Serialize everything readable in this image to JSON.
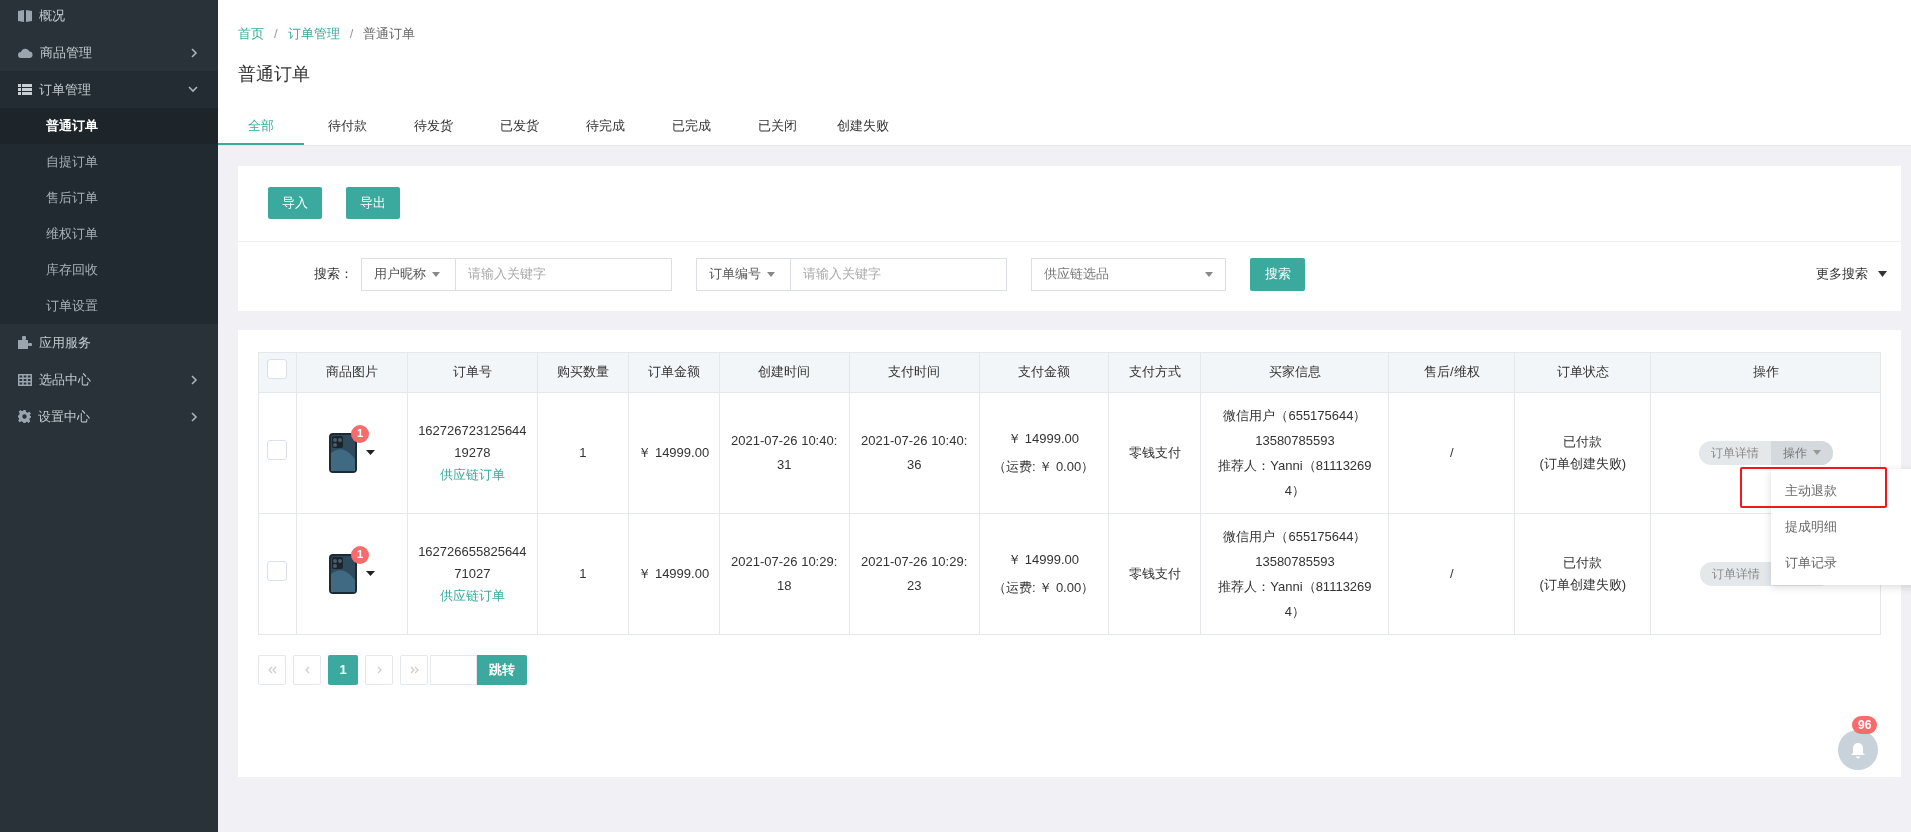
{
  "sidebar": {
    "items": [
      {
        "label": "概况"
      },
      {
        "label": "商品管理",
        "expanded": false
      },
      {
        "label": "订单管理",
        "expanded": true,
        "children": [
          {
            "label": "普通订单",
            "selected": true
          },
          {
            "label": "自提订单",
            "selected": false
          },
          {
            "label": "售后订单",
            "selected": false
          },
          {
            "label": "维权订单",
            "selected": false
          },
          {
            "label": "库存回收",
            "selected": false
          },
          {
            "label": "订单设置",
            "selected": false
          }
        ]
      },
      {
        "label": "应用服务"
      },
      {
        "label": "选品中心",
        "expanded": false
      },
      {
        "label": "设置中心",
        "expanded": false
      }
    ]
  },
  "breadcrumb": [
    {
      "kind": "crumb",
      "label": "首页",
      "link": true
    },
    {
      "kind": "separator",
      "label": "/"
    },
    {
      "kind": "crumb",
      "label": "订单管理",
      "link": true
    },
    {
      "kind": "separator",
      "label": "/"
    },
    {
      "kind": "crumb",
      "label": "普通订单",
      "link": false
    }
  ],
  "page_title": "普通订单",
  "tabs": [
    {
      "label": "全部",
      "selected": true
    },
    {
      "label": "待付款",
      "selected": false
    },
    {
      "label": "待发货",
      "selected": false
    },
    {
      "label": "已发货",
      "selected": false
    },
    {
      "label": "待完成",
      "selected": false
    },
    {
      "label": "已完成",
      "selected": false
    },
    {
      "label": "已关闭",
      "selected": false
    },
    {
      "label": "创建失败",
      "selected": false
    }
  ],
  "toolbar": {
    "buttons": [
      "导入",
      "导出"
    ]
  },
  "search": {
    "label": "搜索：",
    "filters": [
      {
        "kind": "select-input",
        "select": "用户昵称",
        "placeholder": "请输入关键字"
      },
      {
        "kind": "select-input",
        "select": "订单编号",
        "placeholder": "请输入关键字"
      },
      {
        "kind": "select",
        "placeholder": "供应链选品"
      }
    ],
    "button": "搜索",
    "more": "更多搜索"
  },
  "table": {
    "select_all_checked": false,
    "columns": [
      "商品图片",
      "订单号",
      "购买数量",
      "订单金额",
      "创建时间",
      "支付时间",
      "支付金额",
      "支付方式",
      "买家信息",
      "售后/维权",
      "订单状态",
      "操作"
    ],
    "rows": [
      {
        "checked": false,
        "image_badge": "1",
        "order_no": "16272672312564419278",
        "order_tag": "供应链订单",
        "quantity": "1",
        "amount": "￥ 14999.00",
        "created": "2021-07-26 10:40:31",
        "paid": "2021-07-26 10:40:36",
        "pay_amount": "￥ 14999.00",
        "shipping": "（运费: ￥ 0.00）",
        "pay_method": "零钱支付",
        "buyer": [
          "微信用户（655175644）",
          "13580785593",
          "推荐人：Yanni（811132694）"
        ],
        "after_sale": "/",
        "status": "已付款",
        "status_note": "(订单创建失败)",
        "actions": [
          "订单详情",
          "操作"
        ]
      },
      {
        "checked": false,
        "image_badge": "1",
        "order_no": "16272665582564471027",
        "order_tag": "供应链订单",
        "quantity": "1",
        "amount": "￥ 14999.00",
        "created": "2021-07-26 10:29:18",
        "paid": "2021-07-26 10:29:23",
        "pay_amount": "￥ 14999.00",
        "shipping": "（运费: ￥ 0.00）",
        "pay_method": "零钱支付",
        "buyer": [
          "微信用户（655175644）",
          "13580785593",
          "推荐人：Yanni（811132694）"
        ],
        "after_sale": "/",
        "status": "已付款",
        "status_note": "(订单创建失败)",
        "actions": [
          "订单详情"
        ]
      }
    ]
  },
  "dropdown": {
    "items": [
      {
        "label": "主动退款",
        "highlighted": true
      },
      {
        "label": "提成明细",
        "highlighted": false
      },
      {
        "label": "订单记录",
        "highlighted": false
      }
    ]
  },
  "pagination": {
    "pages": [
      {
        "label": "1",
        "selected": true
      }
    ],
    "jump_button": "跳转"
  },
  "notifications": {
    "count": "96"
  }
}
